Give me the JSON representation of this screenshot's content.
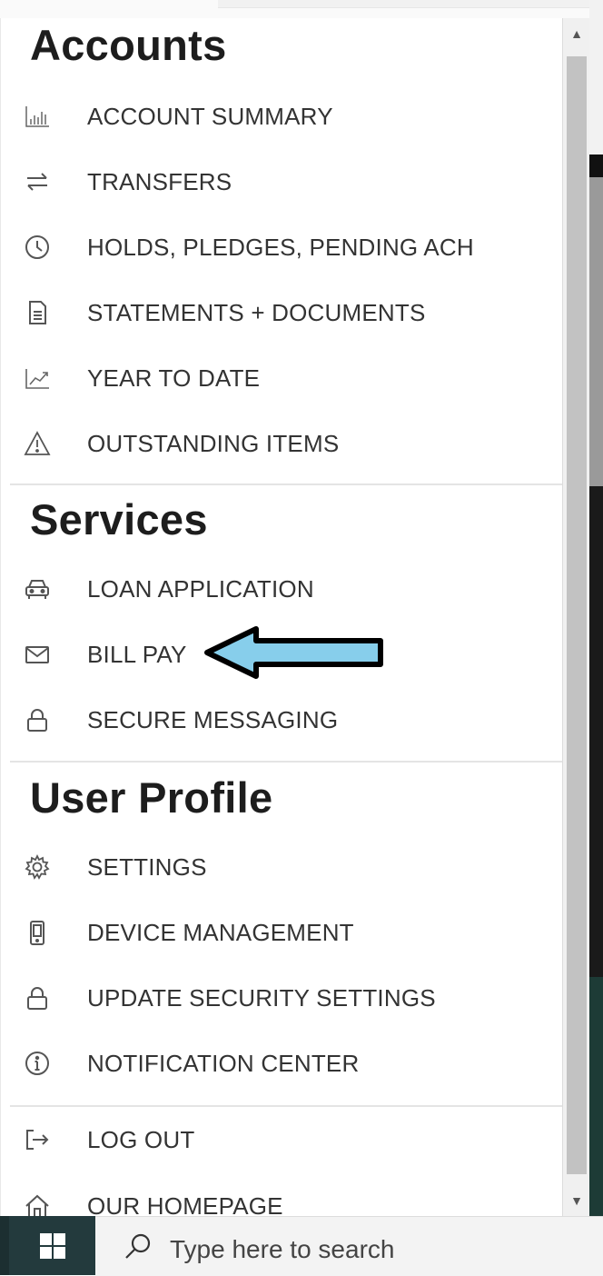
{
  "sections": [
    {
      "title": "Accounts",
      "items": [
        {
          "label": "ACCOUNT SUMMARY",
          "icon": "bar-chart-icon"
        },
        {
          "label": "TRANSFERS",
          "icon": "transfer-arrows-icon"
        },
        {
          "label": "HOLDS, PLEDGES, PENDING ACH",
          "icon": "clock-icon"
        },
        {
          "label": "STATEMENTS + DOCUMENTS",
          "icon": "document-icon"
        },
        {
          "label": "YEAR TO DATE",
          "icon": "trend-chart-icon"
        },
        {
          "label": "OUTSTANDING ITEMS",
          "icon": "warning-icon"
        }
      ]
    },
    {
      "title": "Services",
      "items": [
        {
          "label": "LOAN APPLICATION",
          "icon": "car-icon"
        },
        {
          "label": "BILL PAY",
          "icon": "envelope-icon"
        },
        {
          "label": "SECURE MESSAGING",
          "icon": "lock-icon"
        }
      ]
    },
    {
      "title": "User Profile",
      "items": [
        {
          "label": "SETTINGS",
          "icon": "gear-icon"
        },
        {
          "label": "DEVICE MANAGEMENT",
          "icon": "phone-icon"
        },
        {
          "label": "UPDATE SECURITY SETTINGS",
          "icon": "lock-icon"
        },
        {
          "label": "NOTIFICATION CENTER",
          "icon": "info-icon"
        }
      ]
    }
  ],
  "footer_items": [
    {
      "label": "LOG OUT",
      "icon": "logout-icon"
    },
    {
      "label": "OUR HOMEPAGE",
      "icon": "home-icon"
    }
  ],
  "taskbar": {
    "search_placeholder": "Type here to search",
    "start_icon": "windows-logo-icon",
    "search_icon": "search-icon"
  },
  "annotation": {
    "arrow_fill": "#87ceeb",
    "arrow_stroke": "#000000"
  }
}
